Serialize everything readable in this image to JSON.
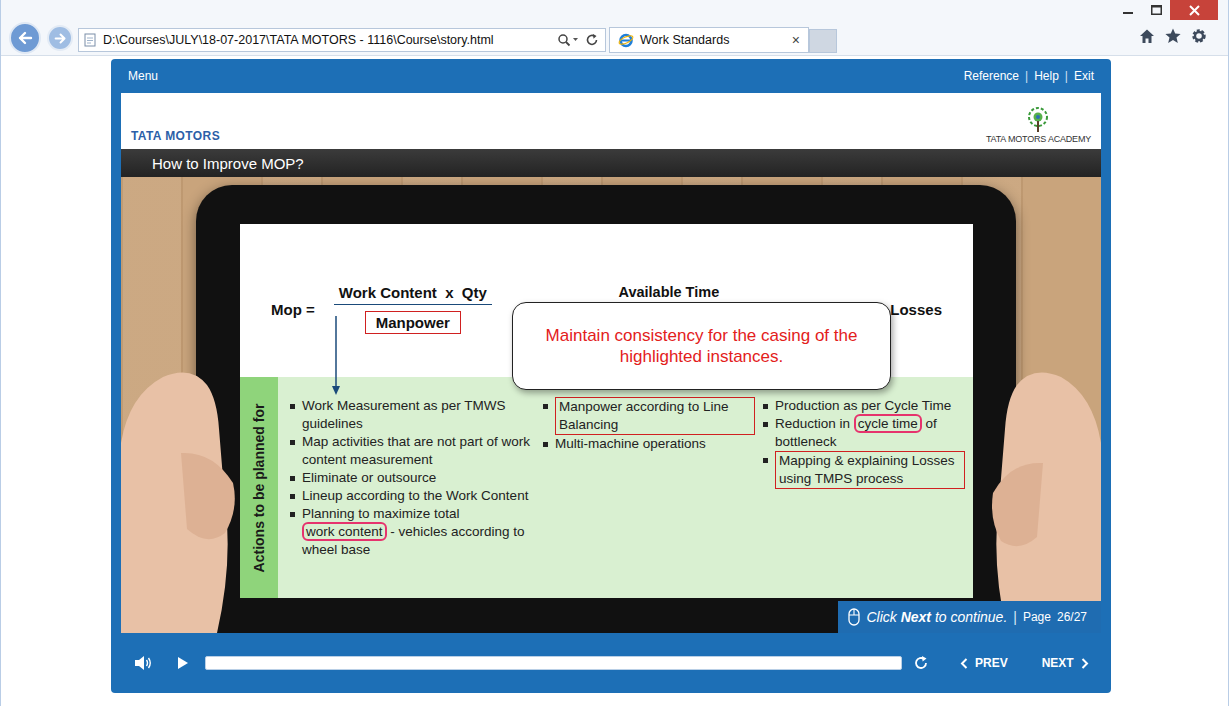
{
  "browser": {
    "address": "D:\\Courses\\JULY\\18-07-2017\\TATA MOTORS - 1116\\Course\\story.html",
    "tabs": [
      {
        "label": "Work Standards",
        "close": "×",
        "selected": true
      }
    ]
  },
  "player": {
    "menu": "Menu",
    "links": [
      "Reference",
      "Help",
      "Exit"
    ],
    "link_separator": "|"
  },
  "slide": {
    "brand": "TATA MOTORS",
    "academy": "TATA MOTORS ACADEMY",
    "title": "How to Improve MOP?",
    "formula": {
      "lhs": "Mop =",
      "numerator": "Work Content  x  Qty",
      "denominator": {
        "text": "Manpower",
        "mark": "box"
      },
      "available": "Available Time",
      "losses": "Losses"
    },
    "callout": "Maintain consistency for the casing of the highlighted instances.",
    "actions_label": "Actions to be planned for",
    "columns": [
      {
        "items": [
          {
            "mark": "none",
            "segments": [
              {
                "text": "Work Measurement as per TMWS guidelines",
                "mark": "none"
              }
            ]
          },
          {
            "mark": "none",
            "segments": [
              {
                "text": "Map activities that are not part of work content measurement",
                "mark": "none"
              }
            ]
          },
          {
            "mark": "none",
            "segments": [
              {
                "text": "Eliminate or outsource",
                "mark": "none"
              }
            ]
          },
          {
            "mark": "none",
            "segments": [
              {
                "text": "Lineup according to the Work Content",
                "mark": "none"
              }
            ]
          },
          {
            "mark": "none",
            "segments": [
              {
                "text": "Planning to maximize total ",
                "mark": "none"
              },
              {
                "text": "work content",
                "mark": "pill"
              },
              {
                "text": " - vehicles according to wheel base",
                "mark": "none"
              }
            ]
          }
        ]
      },
      {
        "items": [
          {
            "mark": "box",
            "segments": [
              {
                "text": "Manpower according to Line Balancing",
                "mark": "none"
              }
            ]
          },
          {
            "mark": "none",
            "segments": [
              {
                "text": "Multi-machine operations",
                "mark": "none"
              }
            ]
          }
        ]
      },
      {
        "items": [
          {
            "mark": "none",
            "segments": [
              {
                "text": "Production as per Cycle Time",
                "mark": "none"
              }
            ]
          },
          {
            "mark": "none",
            "segments": [
              {
                "text": "Reduction in ",
                "mark": "none"
              },
              {
                "text": "cycle time",
                "mark": "pill"
              },
              {
                "text": " of bottleneck",
                "mark": "none"
              }
            ]
          },
          {
            "mark": "box",
            "segments": [
              {
                "text": "Mapping & explaining Losses using TMPS process",
                "mark": "none"
              }
            ]
          }
        ]
      }
    ],
    "footer": {
      "hint": [
        {
          "text": "Click ",
          "bold": false
        },
        {
          "text": "Next",
          "bold": true
        },
        {
          "text": " to continue.",
          "bold": false
        }
      ],
      "separator": "|",
      "page_label": "Page",
      "page": "26/27"
    }
  },
  "controls": {
    "progress": {
      "level": 0
    },
    "prev": "PREV",
    "next": "NEXT"
  }
}
